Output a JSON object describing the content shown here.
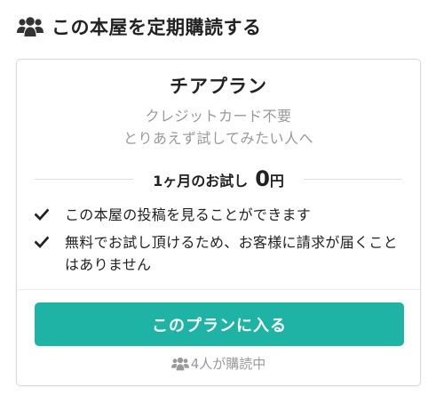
{
  "header": {
    "icon": "users-icon",
    "title": "この本屋を定期購読する"
  },
  "plan": {
    "name": "チアプラン",
    "subtitle_line1": "クレジットカード不要",
    "subtitle_line2": "とりあえず試してみたい人へ",
    "trial_label": "1ヶ月のお試し",
    "trial_price": "0",
    "trial_unit": "円",
    "benefits": [
      {
        "icon": "check-icon",
        "text": "この本屋の投稿を見ることができます"
      },
      {
        "icon": "check-icon",
        "text": "無料でお試し頂けるため、お客様に請求が届くことはありません"
      }
    ],
    "button_label": "このプランに入る",
    "subscriber_icon": "users-icon",
    "subscriber_text": "4人が購読中"
  },
  "colors": {
    "accent": "#1fb3a5",
    "muted_text": "#999999",
    "text": "#222222",
    "border": "#d9d9d9"
  }
}
